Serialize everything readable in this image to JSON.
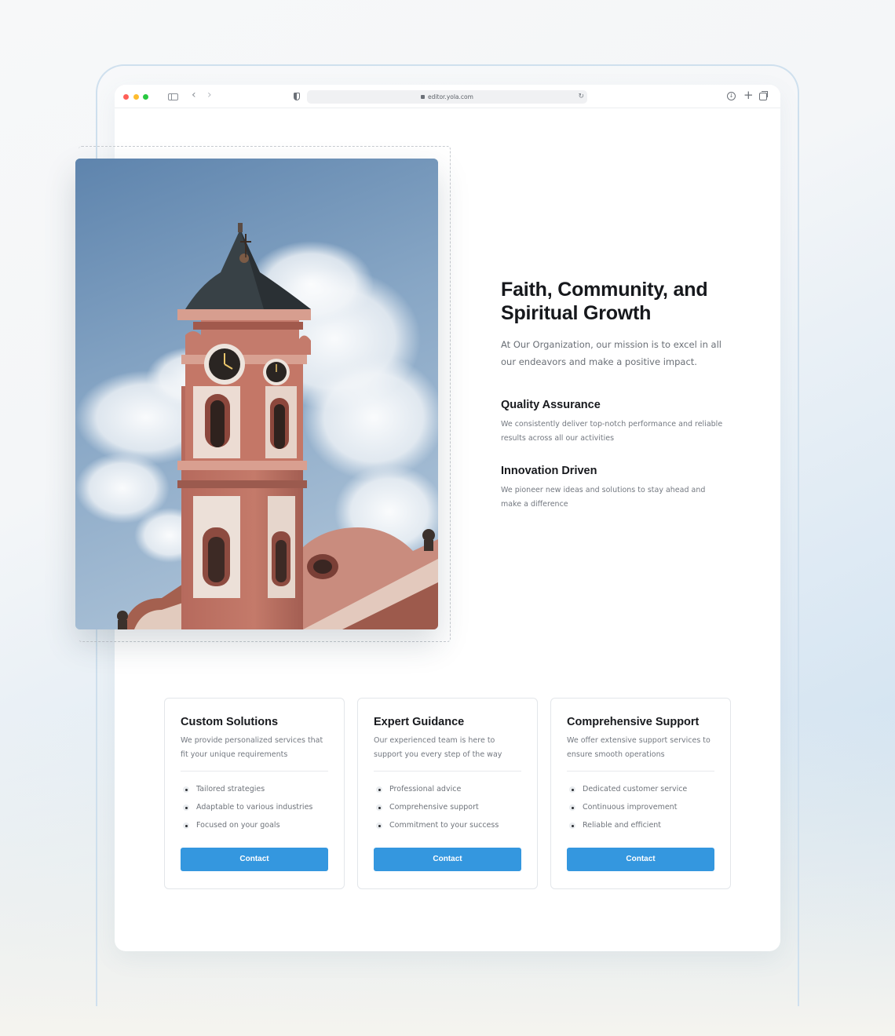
{
  "browser": {
    "url": "editor.yola.com"
  },
  "icons": {
    "window_controls": [
      "close-dot",
      "minimize-dot",
      "zoom-dot"
    ],
    "toolbar": [
      "sidebar-icon",
      "back-icon",
      "forward-icon",
      "shield-icon",
      "lock-icon",
      "reload-icon",
      "download-icon",
      "plus-icon",
      "tabs-icon"
    ]
  },
  "hero": {
    "title": "Faith, Community, and Spiritual Growth",
    "lead": "At Our Organization, our mission is to excel in all our endeavors and make a positive impact.",
    "features": [
      {
        "title": "Quality Assurance",
        "description": "We consistently deliver top-notch performance and reliable results across all our activities"
      },
      {
        "title": "Innovation Driven",
        "description": "We pioneer new ideas and solutions to stay ahead and make a difference"
      }
    ]
  },
  "cards": [
    {
      "title": "Custom Solutions",
      "description": "We provide personalized services that fit your unique requirements",
      "items": [
        "Tailored strategies",
        "Adaptable to various industries",
        "Focused on your goals"
      ],
      "button": "Contact"
    },
    {
      "title": "Expert Guidance",
      "description": "Our experienced team is here to support you every step of the way",
      "items": [
        "Professional advice",
        "Comprehensive support",
        "Commitment to your success"
      ],
      "button": "Contact"
    },
    {
      "title": "Comprehensive Support",
      "description": "We offer extensive support services to ensure smooth operations",
      "items": [
        "Dedicated customer service",
        "Continuous improvement",
        "Reliable and efficient"
      ],
      "button": "Contact"
    }
  ],
  "colors": {
    "accent": "#3497df",
    "heading": "#16181c",
    "body_text": "#6a6f76"
  }
}
